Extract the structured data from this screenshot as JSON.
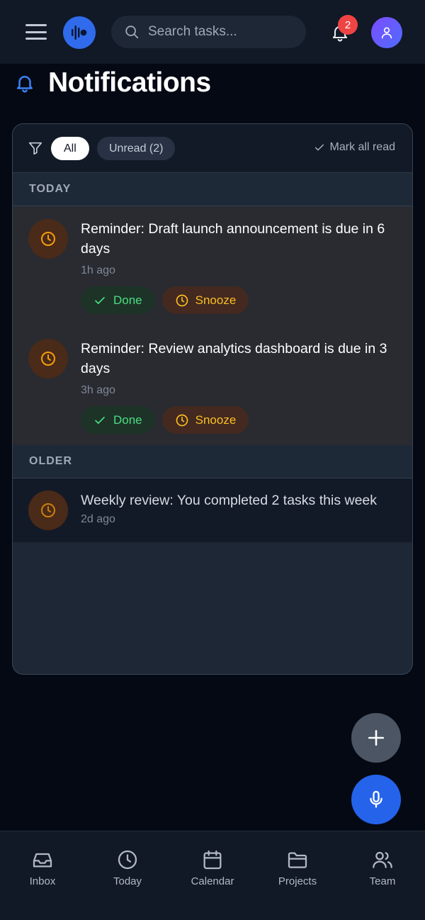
{
  "header": {
    "search_placeholder": "Search tasks...",
    "notification_count": "2"
  },
  "page": {
    "title": "Notifications"
  },
  "filters": {
    "all_label": "All",
    "unread_label": "Unread (2)",
    "mark_all_read_label": "Mark all read"
  },
  "sections": {
    "today": {
      "label": "TODAY",
      "items": [
        {
          "text": "Reminder: Draft launch announcement is due in 6 days",
          "time": "1h ago",
          "done_label": "Done",
          "snooze_label": "Snooze"
        },
        {
          "text": "Reminder: Review analytics dashboard is due in 3 days",
          "time": "3h ago",
          "done_label": "Done",
          "snooze_label": "Snooze"
        }
      ]
    },
    "older": {
      "label": "OLDER",
      "items": [
        {
          "text": "Weekly review: You completed 2 tasks this week",
          "time": "2d ago"
        }
      ]
    }
  },
  "bottom_nav": {
    "items": [
      {
        "label": "Inbox",
        "icon": "inbox-icon"
      },
      {
        "label": "Today",
        "icon": "clock-icon"
      },
      {
        "label": "Calendar",
        "icon": "calendar-icon"
      },
      {
        "label": "Projects",
        "icon": "folder-icon"
      },
      {
        "label": "Team",
        "icon": "users-icon"
      }
    ]
  },
  "colors": {
    "accent": "#2563eb",
    "badge": "#ef4444",
    "done": "#4ade80",
    "snooze": "#fbbf24"
  }
}
